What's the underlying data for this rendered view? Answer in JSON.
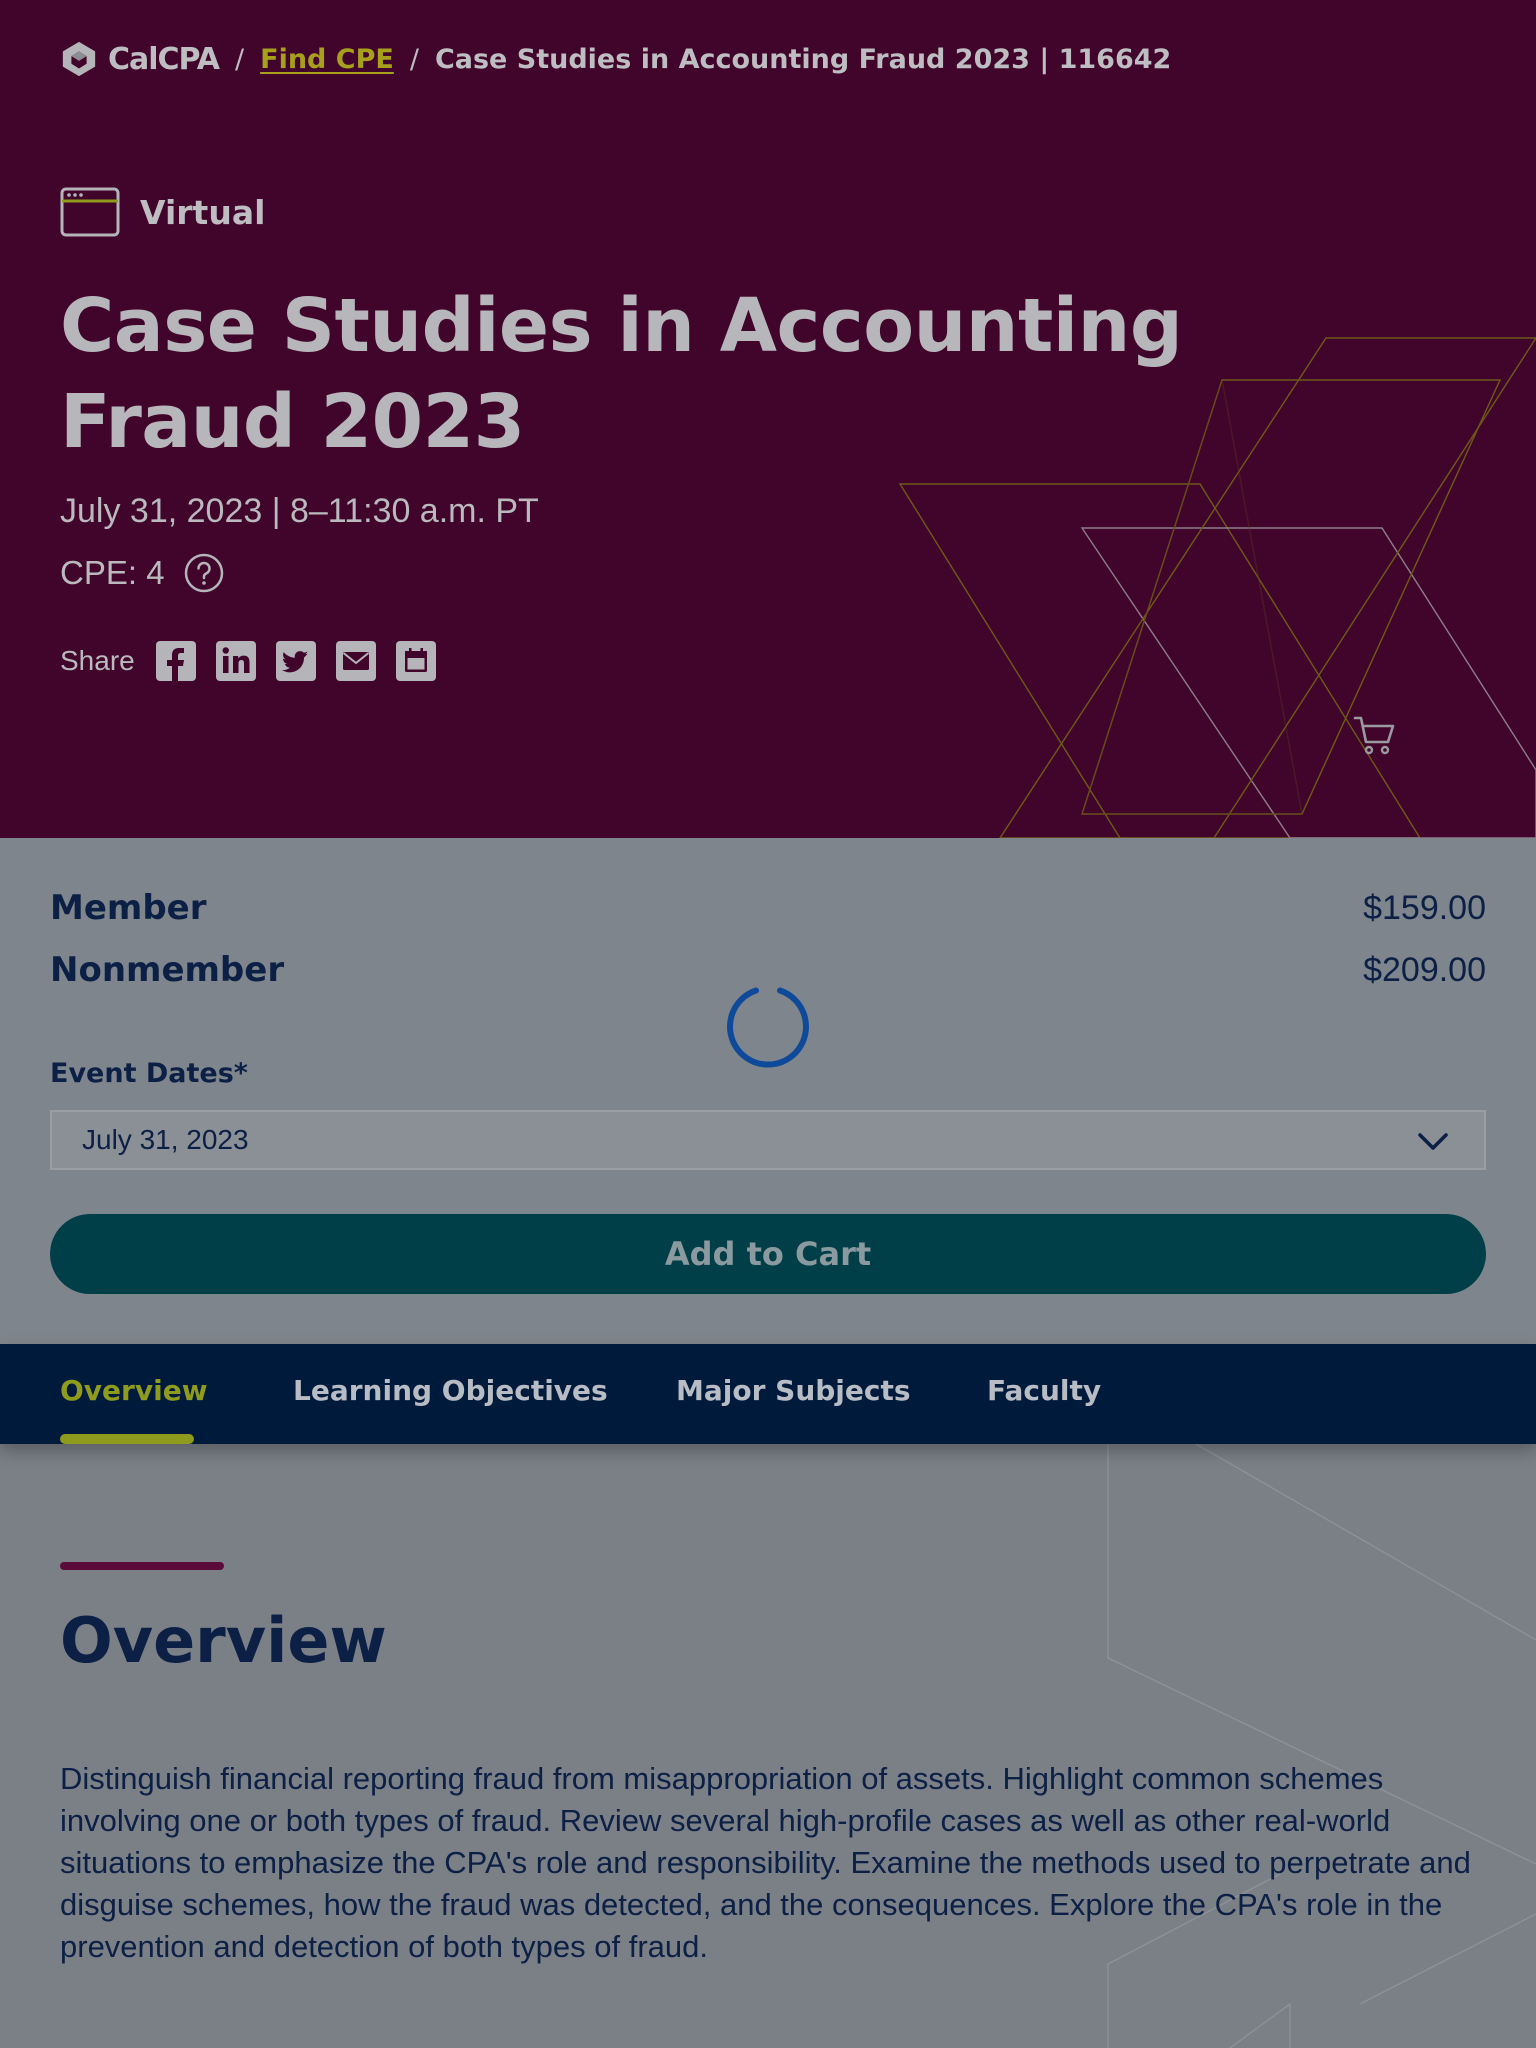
{
  "breadcrumb": {
    "logo_text": "CalCPA",
    "separator": "/",
    "link": "Find CPE",
    "current": "Case Studies in Accounting Fraud 2023 | 116642"
  },
  "event": {
    "format": "Virtual",
    "title": "Case Studies in Accounting Fraud 2023",
    "date_time": "July 31, 2023 | 8–11:30 a.m. PT",
    "cpe": "CPE: 4",
    "share_label": "Share",
    "share_icons": [
      "facebook-icon",
      "linkedin-icon",
      "twitter-icon",
      "email-icon",
      "calendar-icon"
    ]
  },
  "pricing": {
    "member_label": "Member",
    "member_price": "$159.00",
    "nonmember_label": "Nonmember",
    "nonmember_price": "$209.00"
  },
  "event_dates": {
    "label": "Event Dates*",
    "selected": "July 31, 2023"
  },
  "add_to_cart_label": "Add to Cart",
  "tabs": [
    {
      "label": "Overview",
      "active": true
    },
    {
      "label": "Learning Objectives",
      "active": false
    },
    {
      "label": "Major Subjects",
      "active": false
    },
    {
      "label": "Faculty",
      "active": false
    }
  ],
  "overview": {
    "heading": "Overview",
    "text": "Distinguish financial reporting fraud from misappropriation of assets. Highlight common schemes involving one or both types of fraud. Review several high-profile cases as well as other real-world situations to emphasize the CPA's role and responsibility. Examine the methods used to perpetrate and disguise schemes, how the fraud was detected, and the consequences. Explore the CPA's role in the prevention and detection of both types of fraud."
  },
  "colors": {
    "hero_bg": "#41052b",
    "accent_lime": "#8e9b1d",
    "link_gold": "#a7a01a",
    "navy": "#0c1f45",
    "tabs_bg": "#001a3c",
    "button_teal": "#003e48"
  }
}
